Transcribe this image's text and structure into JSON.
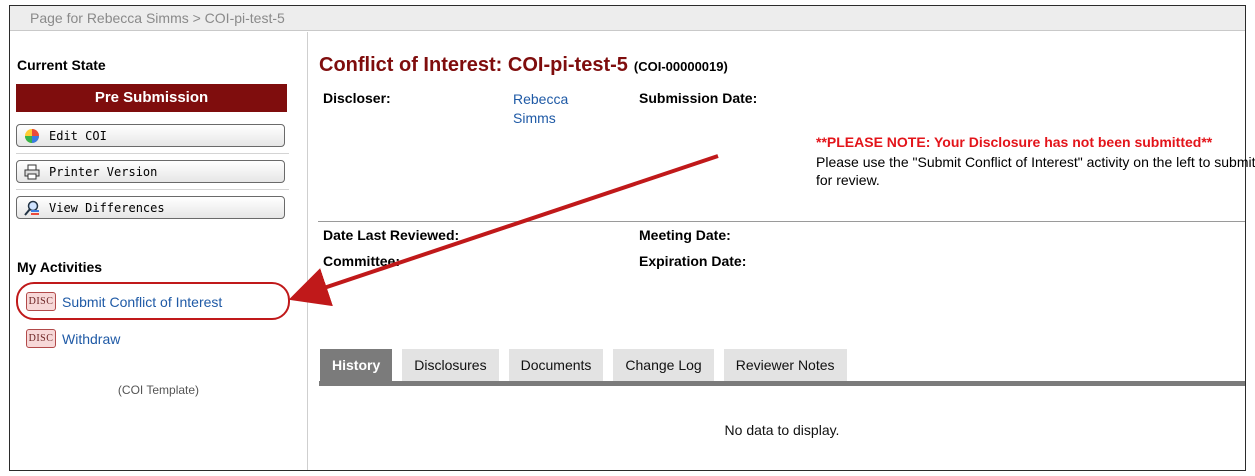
{
  "breadcrumb": {
    "text": "Page for Rebecca Simms  >  COI-pi-test-5"
  },
  "sidebar": {
    "current_state_heading": "Current State",
    "state": "Pre Submission",
    "actions": [
      {
        "label": "Edit COI",
        "icon": "color-circle-icon"
      },
      {
        "label": "Printer Version",
        "icon": "printer-icon"
      },
      {
        "label": "View Differences",
        "icon": "magnify-compare-icon"
      }
    ],
    "activities_heading": "My Activities",
    "activities": [
      {
        "badge": "DISC",
        "label": "Submit Conflict of Interest"
      },
      {
        "badge": "DISC",
        "label": "Withdraw"
      }
    ],
    "template_label": "(COI Template)"
  },
  "main": {
    "title": "Conflict of Interest: COI-pi-test-5",
    "record_id": "(COI-00000019)",
    "discloser_label": "Discloser:",
    "discloser_value": "Rebecca Simms",
    "submission_date_label": "Submission Date:",
    "note_warning": "**PLEASE NOTE: Your Disclosure has not been submitted**",
    "note_text": "Please use the \"Submit Conflict of Interest\" activity on the left to submit for review.",
    "date_last_reviewed_label": "Date Last Reviewed:",
    "meeting_date_label": "Meeting Date:",
    "committee_label": "Committee:",
    "expiration_date_label": "Expiration Date:",
    "tabs": [
      "History",
      "Disclosures",
      "Documents",
      "Change Log",
      "Reviewer Notes"
    ],
    "active_tab": "History",
    "empty_message": "No data to display."
  },
  "colors": {
    "brand": "#7f0d0d",
    "link": "#1f5aa6",
    "warning": "#e3141a",
    "annotation": "#c0191a"
  }
}
